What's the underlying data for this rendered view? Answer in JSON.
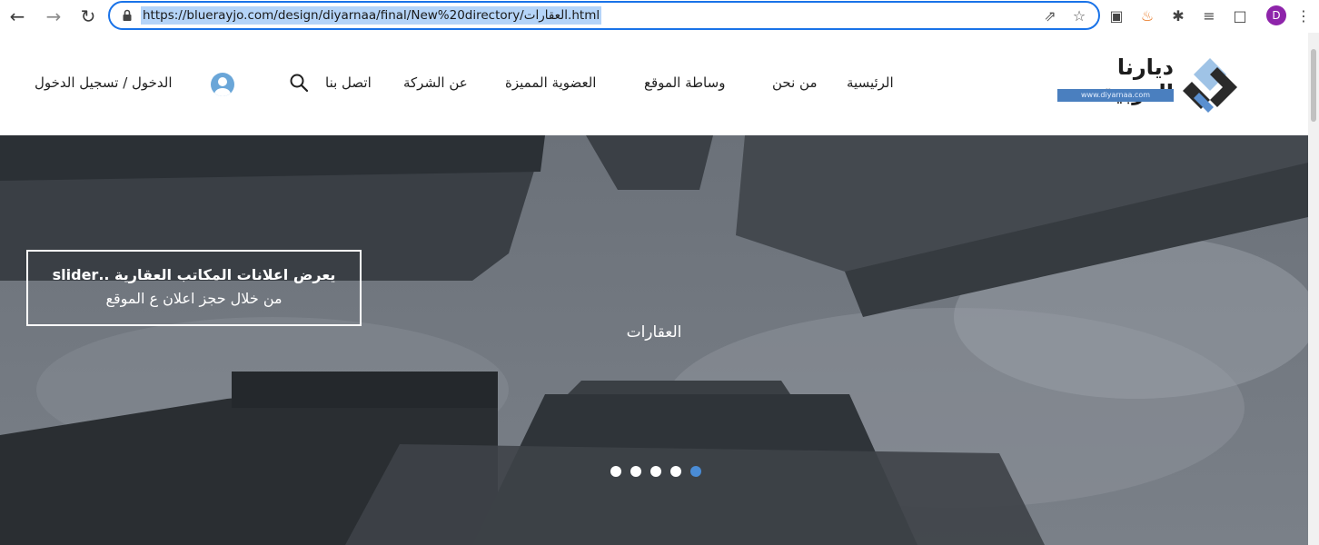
{
  "browser": {
    "url": "https://bluerayjo.com/design/diyarnaa/final/New%20directory/العقارات.html",
    "profile_initial": "D"
  },
  "site": {
    "logo": {
      "title": "ديارنا العربية",
      "url_text": "www.diyarnaa.com"
    },
    "menu": {
      "home": "الرئيسية",
      "about": "من نحن",
      "brokerage": "وساطة الموقع",
      "membership": "العضوية المميزة",
      "company": "عن الشركة",
      "contact": "اتصل بنا"
    },
    "login_label": "الدخول / تسجيل الدخول"
  },
  "hero": {
    "title": "العقارات",
    "note_line1": "يعرض اعلانات المكاتب العقارية  ..slider",
    "note_line2": "من خلال حجز اعلان ع الموقع",
    "slide_count": 5,
    "active_slide": 5
  },
  "colors": {
    "accent": "#1a73e8",
    "logo_blue": "#4a7fbf",
    "dot_active": "#4a8cd6",
    "profile": "#8e24aa"
  }
}
